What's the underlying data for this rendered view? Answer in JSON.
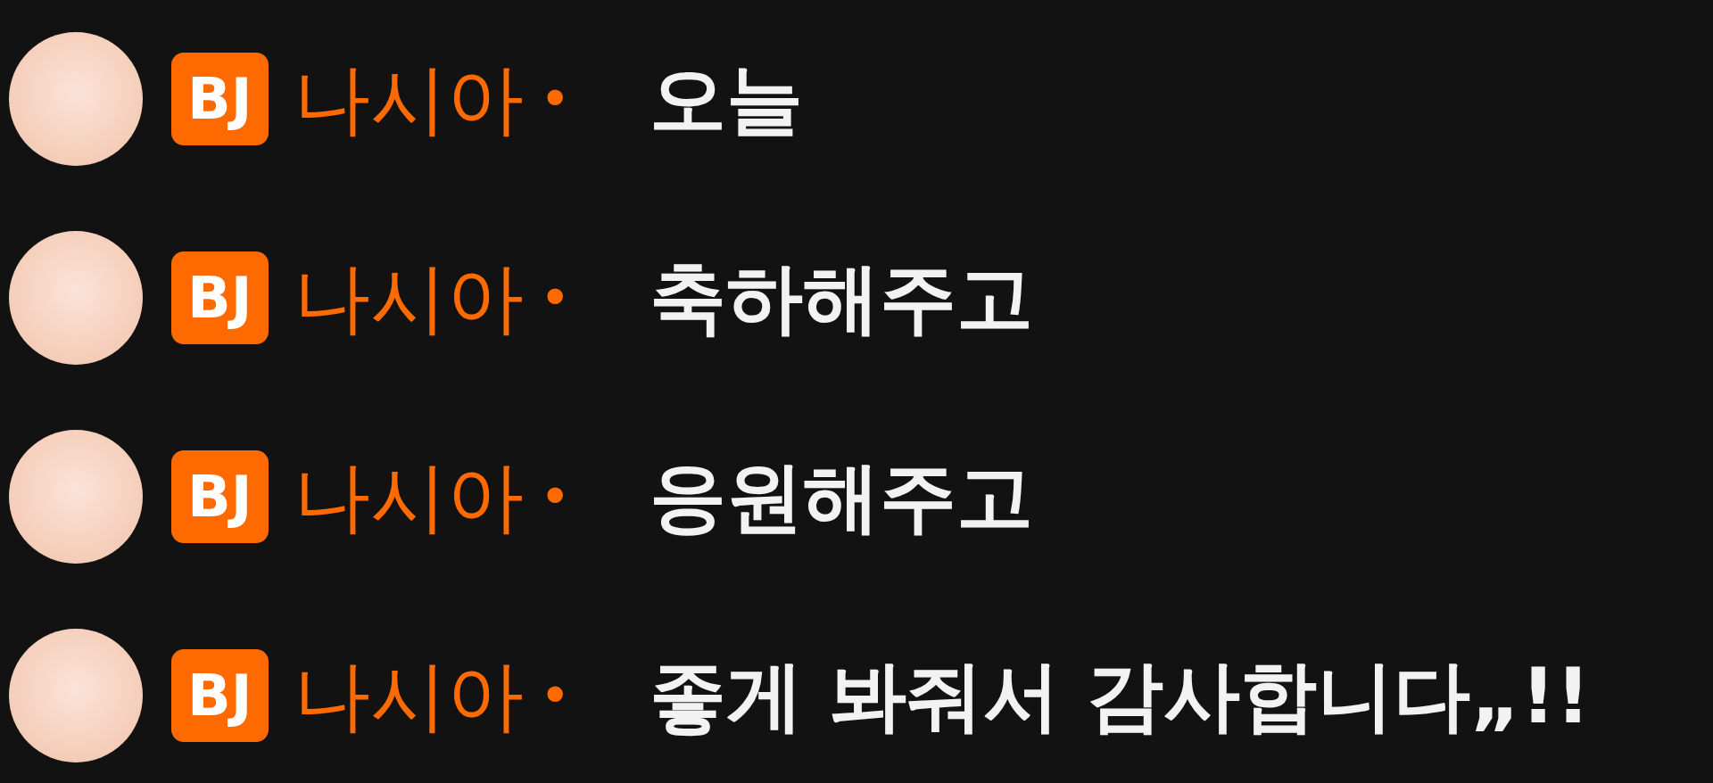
{
  "messages": [
    {
      "badge": "BJ",
      "name": "나시아",
      "separator": "•",
      "text": "오늘"
    },
    {
      "badge": "BJ",
      "name": "나시아",
      "separator": "•",
      "text": "축하해주고"
    },
    {
      "badge": "BJ",
      "name": "나시아",
      "separator": "•",
      "text": "응원해주고"
    },
    {
      "badge": "BJ",
      "name": "나시아",
      "separator": "•",
      "text": "좋게 봐줘서 감사합니다„!!"
    }
  ]
}
